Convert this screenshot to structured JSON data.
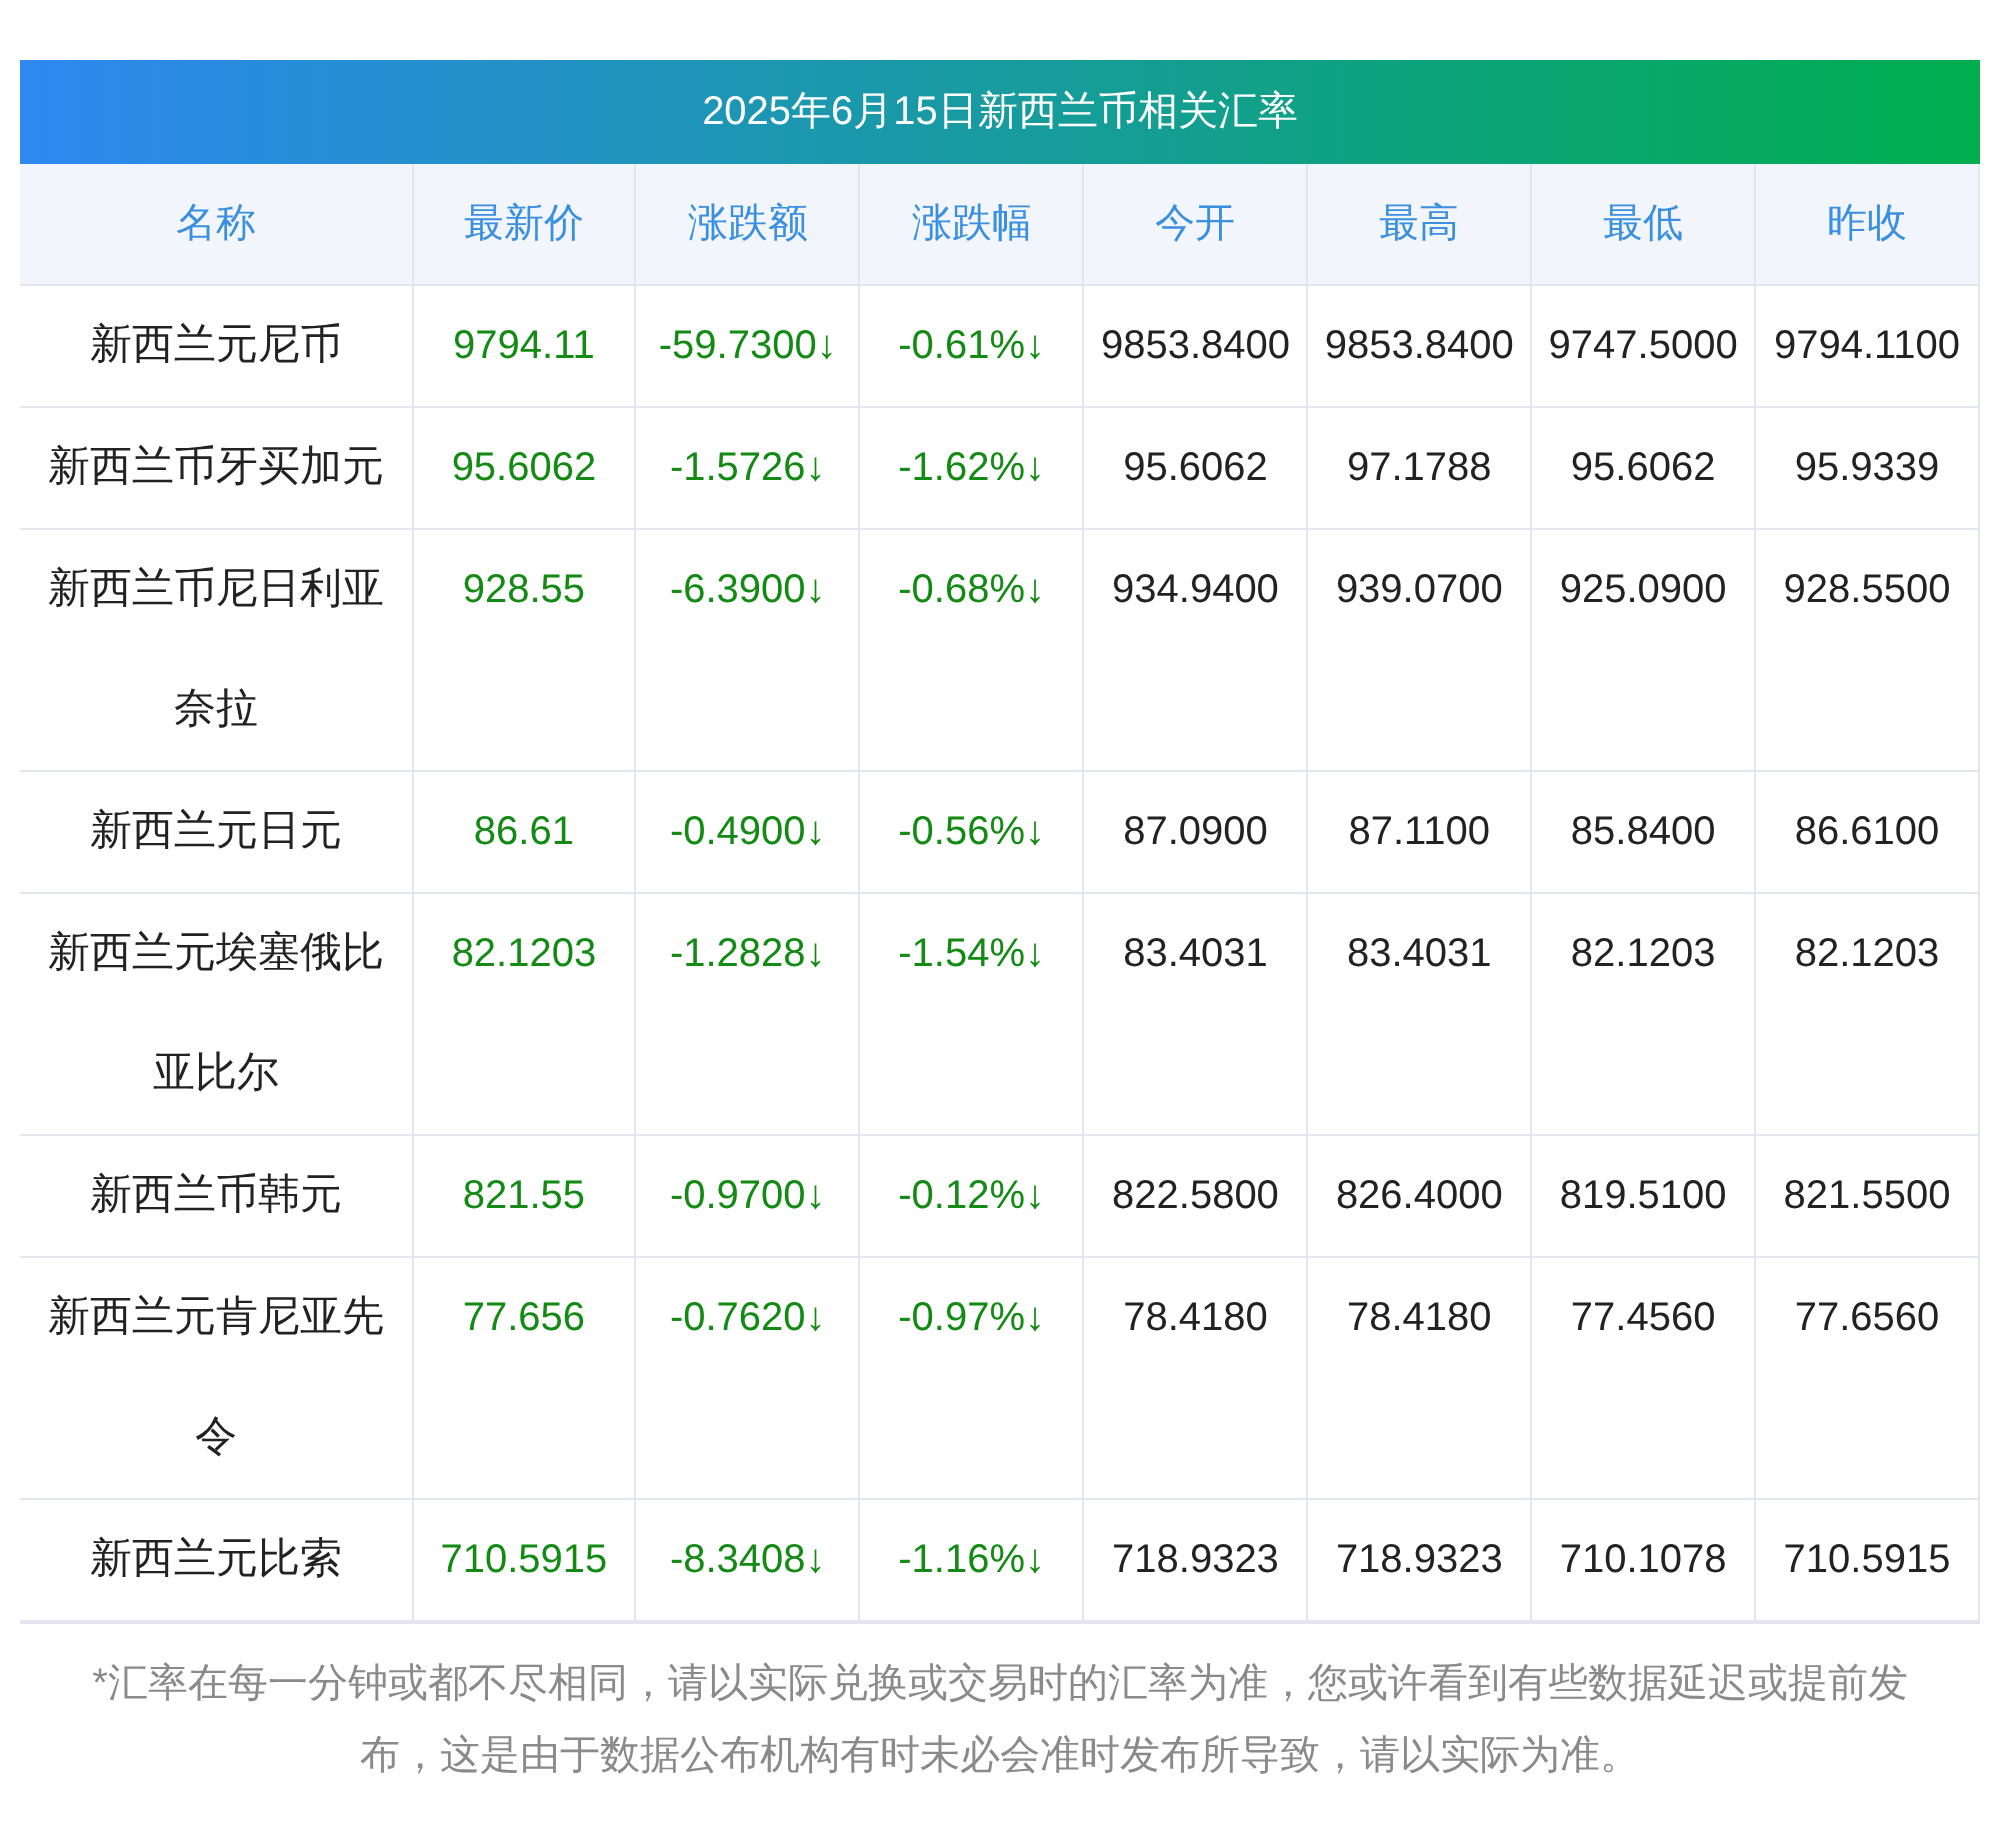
{
  "title": "2025年6月15日新西兰币相关汇率",
  "columns": [
    "名称",
    "最新价",
    "涨跌额",
    "涨跌幅",
    "今开",
    "最高",
    "最低",
    "昨收"
  ],
  "rows": [
    {
      "name": "新西兰元尼币",
      "color": "#138a13",
      "latest": "9794.11",
      "change": "-59.7300↓",
      "change_pct": "-0.61%↓",
      "open": "9853.8400",
      "high": "9853.8400",
      "low": "9747.5000",
      "prev_close": "9794.1100"
    },
    {
      "name": "新西兰币牙买加元",
      "color": "#138a13",
      "latest": "95.6062",
      "change": "-1.5726↓",
      "change_pct": "-1.62%↓",
      "open": "95.6062",
      "high": "97.1788",
      "low": "95.6062",
      "prev_close": "95.9339"
    },
    {
      "name": "新西兰币尼日利亚奈拉",
      "color": "#138a13",
      "latest": "928.55",
      "change": "-6.3900↓",
      "change_pct": "-0.68%↓",
      "open": "934.9400",
      "high": "939.0700",
      "low": "925.0900",
      "prev_close": "928.5500"
    },
    {
      "name": "新西兰元日元",
      "color": "#138a13",
      "latest": "86.61",
      "change": "-0.4900↓",
      "change_pct": "-0.56%↓",
      "open": "87.0900",
      "high": "87.1100",
      "low": "85.8400",
      "prev_close": "86.6100"
    },
    {
      "name": "新西兰元埃塞俄比亚比尔",
      "color": "#138a13",
      "latest": "82.1203",
      "change": "-1.2828↓",
      "change_pct": "-1.54%↓",
      "open": "83.4031",
      "high": "83.4031",
      "low": "82.1203",
      "prev_close": "82.1203"
    },
    {
      "name": "新西兰币韩元",
      "color": "#138a13",
      "latest": "821.55",
      "change": "-0.9700↓",
      "change_pct": "-0.12%↓",
      "open": "822.5800",
      "high": "826.4000",
      "low": "819.5100",
      "prev_close": "821.5500"
    },
    {
      "name": "新西兰元肯尼亚先令",
      "color": "#138a13",
      "latest": "77.656",
      "change": "-0.7620↓",
      "change_pct": "-0.97%↓",
      "open": "78.4180",
      "high": "78.4180",
      "low": "77.4560",
      "prev_close": "77.6560"
    },
    {
      "name": "新西兰元比索",
      "color": "#138a13",
      "latest": "710.5915",
      "change": "-8.3408↓",
      "change_pct": "-1.16%↓",
      "open": "718.9323",
      "high": "718.9323",
      "low": "710.1078",
      "prev_close": "710.5915"
    }
  ],
  "footnote": "*汇率在每一分钟或都不尽相同，请以实际兑换或交易时的汇率为准，您或许看到有些数据延迟或提前发布，这是由于数据公布机构有时未必会准时发布所导致，请以实际为准。"
}
